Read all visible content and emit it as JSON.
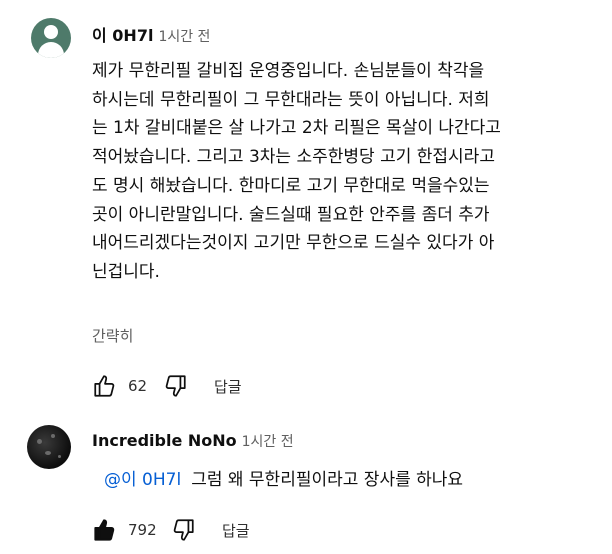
{
  "comments": [
    {
      "author": "이 0H7l",
      "time": "1시간 전",
      "lines": [
        "제가 무한리필 갈비집 운영중입니다. 손님분들이 착각을",
        "하시는데 무한리필이 그 무한대라는 뜻이 아닙니다. 저희",
        "는 1차 갈비대붙은 살 나가고 2차 리필은 목살이 나간다고",
        "적어놨습니다. 그리고 3차는 소주한병당 고기 한접시라고",
        "도 명시 해놨습니다. 한마디로 고기 무한대로 먹을수있는",
        "곳이 아니란말입니다. 술드실때 필요한 안주를 좀더 추가",
        "내어드리겠다는것이지 고기만 무한으로 드실수 있다가 아",
        "닌겁니다."
      ],
      "collapse_label": "간략히",
      "likes": "62",
      "reply_label": "답글",
      "liked": false
    },
    {
      "author": "Incredible NoNo",
      "time": "1시간 전",
      "mention": "@이 0H7l",
      "text": "그럼 왜 무한리필이라고 장사를 하나요",
      "likes": "792",
      "reply_label": "답글",
      "liked": true
    }
  ],
  "icons": {
    "avatar1": "person-avatar-icon",
    "like": "thumbs-up-icon",
    "dislike": "thumbs-down-icon"
  },
  "colors": {
    "mention": "#065fd4",
    "secondary_text": "#606060",
    "avatar1_bg": "#4e7a6a"
  }
}
